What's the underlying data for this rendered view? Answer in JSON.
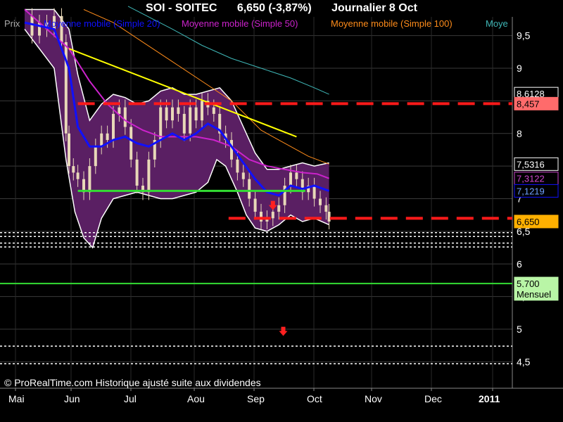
{
  "header": {
    "symbol": "SOI - SOITEC",
    "quote": "6,650 (-3,87%)",
    "period": "Journalier  8 Oct"
  },
  "legend": {
    "prix": "Prix",
    "ma20": "Moyenne mobile (Simple 20)",
    "ma50": "Moyenne mobile (Simple 50)",
    "ma100": "Moyenne mobile (Simple 100)",
    "ma_extra": "Moye"
  },
  "footer": "© ProRealTime.com Historique ajusté suite aux dividendes",
  "colors": {
    "background": "#000000",
    "band_fill": "#5a1f63",
    "band_edge": "#ffffff",
    "ma20": "#1010ff",
    "ma50": "#cc22cc",
    "ma100": "#ff8c1a",
    "ma_extra": "#3fb7b7",
    "trendline": "#ffff00",
    "support_green": "#33dd33",
    "resistance_red": "#ff1a1a",
    "dotted_white": "#ffffff",
    "price_tag_bg": "#ffb000",
    "tag_pink_bg": "#ff6b6b"
  },
  "chart_data": {
    "type": "line",
    "title": "SOI - SOITEC",
    "x_ticks": [
      "Mai",
      "Jun",
      "Jul",
      "Aou",
      "Sep",
      "Oct",
      "Nov",
      "Dec",
      "2011"
    ],
    "y_ticks": [
      "4,5",
      "5",
      "5,5",
      "6",
      "6,5",
      "7",
      "7,5",
      "8",
      "8,5",
      "9",
      "9,5"
    ],
    "y_tick_values": [
      4.5,
      5,
      5.5,
      6,
      6.5,
      7,
      7.5,
      8,
      8.5,
      9,
      9.5
    ],
    "ylim": [
      4.2,
      9.8
    ],
    "x_range_days": [
      0,
      245
    ],
    "grid": true,
    "price_tags": [
      {
        "label": "8,6128",
        "value": 8.61,
        "style": "plain"
      },
      {
        "label": "8,457",
        "value": 8.457,
        "style": "pink"
      },
      {
        "label": "7,5316",
        "value": 7.53,
        "style": "plain"
      },
      {
        "label": "7,3122",
        "value": 7.31,
        "style": "purple"
      },
      {
        "label": "7,1219",
        "value": 7.12,
        "style": "blue"
      },
      {
        "label": "6,650",
        "value": 6.65,
        "style": "orange"
      },
      {
        "label": "5,700",
        "value": 5.7,
        "style": "green"
      },
      {
        "label": "Mensuel",
        "value": 5.54,
        "style": "green"
      }
    ],
    "series": {
      "price": [
        [
          0,
          9.8
        ],
        [
          5,
          9.5
        ],
        [
          10,
          9.7
        ],
        [
          15,
          9.6
        ],
        [
          20,
          9.8
        ],
        [
          25,
          9.4
        ],
        [
          28,
          8.0
        ],
        [
          30,
          7.5
        ],
        [
          33,
          7.4
        ],
        [
          36,
          7.3
        ],
        [
          40,
          7.1
        ],
        [
          44,
          7.5
        ],
        [
          48,
          7.8
        ],
        [
          52,
          8.0
        ],
        [
          56,
          7.9
        ],
        [
          60,
          8.3
        ],
        [
          64,
          8.4
        ],
        [
          68,
          8.1
        ],
        [
          72,
          7.6
        ],
        [
          76,
          7.2
        ],
        [
          80,
          7.1
        ],
        [
          84,
          7.6
        ],
        [
          88,
          7.9
        ],
        [
          92,
          8.4
        ],
        [
          96,
          8.2
        ],
        [
          100,
          8.4
        ],
        [
          104,
          8.3
        ],
        [
          108,
          8.0
        ],
        [
          112,
          8.4
        ],
        [
          116,
          8.2
        ],
        [
          120,
          8.5
        ],
        [
          124,
          8.4
        ],
        [
          128,
          8.3
        ],
        [
          132,
          8.0
        ],
        [
          136,
          7.9
        ],
        [
          140,
          7.6
        ],
        [
          144,
          7.4
        ],
        [
          148,
          7.3
        ],
        [
          152,
          7.0
        ],
        [
          156,
          6.8
        ],
        [
          160,
          6.65
        ],
        [
          164,
          6.7
        ],
        [
          168,
          6.8
        ],
        [
          172,
          6.9
        ],
        [
          176,
          7.2
        ],
        [
          180,
          7.4
        ],
        [
          184,
          7.3
        ],
        [
          188,
          7.1
        ],
        [
          192,
          7.2
        ],
        [
          196,
          7.0
        ],
        [
          200,
          6.9
        ],
        [
          204,
          6.8
        ],
        [
          206,
          6.65
        ]
      ],
      "ma20": [
        [
          0,
          9.7
        ],
        [
          20,
          9.6
        ],
        [
          30,
          9.0
        ],
        [
          36,
          8.1
        ],
        [
          44,
          7.8
        ],
        [
          52,
          7.8
        ],
        [
          60,
          7.9
        ],
        [
          68,
          7.95
        ],
        [
          76,
          7.85
        ],
        [
          84,
          7.8
        ],
        [
          92,
          7.9
        ],
        [
          100,
          8.0
        ],
        [
          108,
          7.9
        ],
        [
          116,
          8.0
        ],
        [
          124,
          8.15
        ],
        [
          132,
          8.05
        ],
        [
          140,
          7.8
        ],
        [
          148,
          7.55
        ],
        [
          156,
          7.3
        ],
        [
          164,
          7.1
        ],
        [
          172,
          7.05
        ],
        [
          180,
          7.2
        ],
        [
          188,
          7.15
        ],
        [
          196,
          7.2
        ],
        [
          206,
          7.12
        ]
      ],
      "ma50": [
        [
          0,
          9.9
        ],
        [
          30,
          9.3
        ],
        [
          44,
          8.8
        ],
        [
          56,
          8.45
        ],
        [
          68,
          8.2
        ],
        [
          80,
          8.05
        ],
        [
          92,
          7.95
        ],
        [
          104,
          7.95
        ],
        [
          116,
          7.95
        ],
        [
          128,
          7.9
        ],
        [
          140,
          7.8
        ],
        [
          152,
          7.6
        ],
        [
          164,
          7.5
        ],
        [
          176,
          7.45
        ],
        [
          188,
          7.4
        ],
        [
          198,
          7.38
        ],
        [
          206,
          7.31
        ]
      ],
      "ma100": [
        [
          40,
          9.9
        ],
        [
          60,
          9.7
        ],
        [
          80,
          9.4
        ],
        [
          100,
          9.1
        ],
        [
          120,
          8.8
        ],
        [
          140,
          8.5
        ],
        [
          160,
          8.05
        ],
        [
          176,
          7.85
        ],
        [
          192,
          7.65
        ],
        [
          206,
          7.53
        ]
      ],
      "ma_extra": [
        [
          70,
          9.95
        ],
        [
          100,
          9.6
        ],
        [
          120,
          9.35
        ],
        [
          140,
          9.15
        ],
        [
          160,
          9.0
        ],
        [
          180,
          8.85
        ],
        [
          196,
          8.7
        ],
        [
          206,
          8.6
        ]
      ],
      "band_upper": [
        [
          0,
          9.9
        ],
        [
          20,
          9.9
        ],
        [
          30,
          9.6
        ],
        [
          36,
          8.9
        ],
        [
          44,
          8.2
        ],
        [
          52,
          8.45
        ],
        [
          60,
          8.6
        ],
        [
          68,
          8.55
        ],
        [
          76,
          8.45
        ],
        [
          84,
          8.5
        ],
        [
          92,
          8.65
        ],
        [
          100,
          8.7
        ],
        [
          108,
          8.6
        ],
        [
          116,
          8.6
        ],
        [
          124,
          8.65
        ],
        [
          132,
          8.7
        ],
        [
          140,
          8.5
        ],
        [
          148,
          8.1
        ],
        [
          156,
          7.7
        ],
        [
          164,
          7.45
        ],
        [
          172,
          7.45
        ],
        [
          180,
          7.5
        ],
        [
          188,
          7.55
        ],
        [
          196,
          7.5
        ],
        [
          206,
          7.55
        ]
      ],
      "band_lower": [
        [
          0,
          9.6
        ],
        [
          20,
          9.0
        ],
        [
          28,
          7.6
        ],
        [
          34,
          6.8
        ],
        [
          40,
          6.4
        ],
        [
          46,
          6.25
        ],
        [
          52,
          6.7
        ],
        [
          60,
          7.0
        ],
        [
          68,
          7.05
        ],
        [
          76,
          7.1
        ],
        [
          84,
          7.05
        ],
        [
          92,
          7.0
        ],
        [
          100,
          7.0
        ],
        [
          108,
          7.05
        ],
        [
          116,
          7.1
        ],
        [
          124,
          7.25
        ],
        [
          130,
          7.6
        ],
        [
          136,
          7.5
        ],
        [
          144,
          7.1
        ],
        [
          150,
          6.75
        ],
        [
          156,
          6.55
        ],
        [
          164,
          6.5
        ],
        [
          172,
          6.6
        ],
        [
          180,
          6.75
        ],
        [
          188,
          6.65
        ],
        [
          196,
          6.7
        ],
        [
          206,
          6.6
        ]
      ]
    },
    "lines": {
      "trend_yellow": [
        [
          30,
          9.3
        ],
        [
          184,
          7.95
        ]
      ],
      "green_support": [
        [
          36,
          7.12
        ],
        [
          190,
          7.12
        ]
      ],
      "green_monthly": 5.7,
      "red_dash_high": 8.457,
      "red_dash_low": 6.7,
      "red_dash_high_start": 36,
      "red_dash_low_start": 138,
      "dotted_levels": [
        6.48,
        6.42,
        6.32,
        6.26,
        4.74,
        4.47
      ]
    },
    "arrows": [
      {
        "x": 168,
        "y": 6.88
      },
      {
        "x": 175,
        "y": 4.95
      }
    ]
  }
}
